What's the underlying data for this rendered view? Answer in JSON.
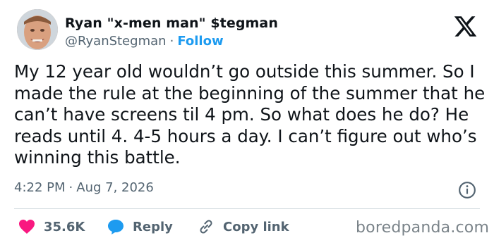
{
  "tweet": {
    "display_name": "Ryan \"x-men man\" $tegman",
    "handle": "@RyanStegman",
    "separator": "·",
    "follow_label": "Follow",
    "text": "My 12 year old wouldn’t go outside this summer. So I made the rule at the beginning of the summer that he can’t have screens til 4 pm. So what does he do? He reads until 4. 4-5 hours a day. I can’t figure out who’s winning this battle.",
    "time": "4:22 PM",
    "date": "Aug 7, 2026"
  },
  "actions": {
    "likes_count": "35.6K",
    "reply_label": "Reply",
    "copy_link_label": "Copy link"
  },
  "watermark": "boredpanda.com",
  "colors": {
    "text": "#0f1419",
    "muted": "#536471",
    "accent": "#1d9bf0",
    "like": "#f91880",
    "divider": "#cfd9de"
  },
  "icons": [
    "x-logo-icon",
    "info-icon",
    "heart-icon",
    "reply-bubble-icon",
    "link-icon"
  ]
}
